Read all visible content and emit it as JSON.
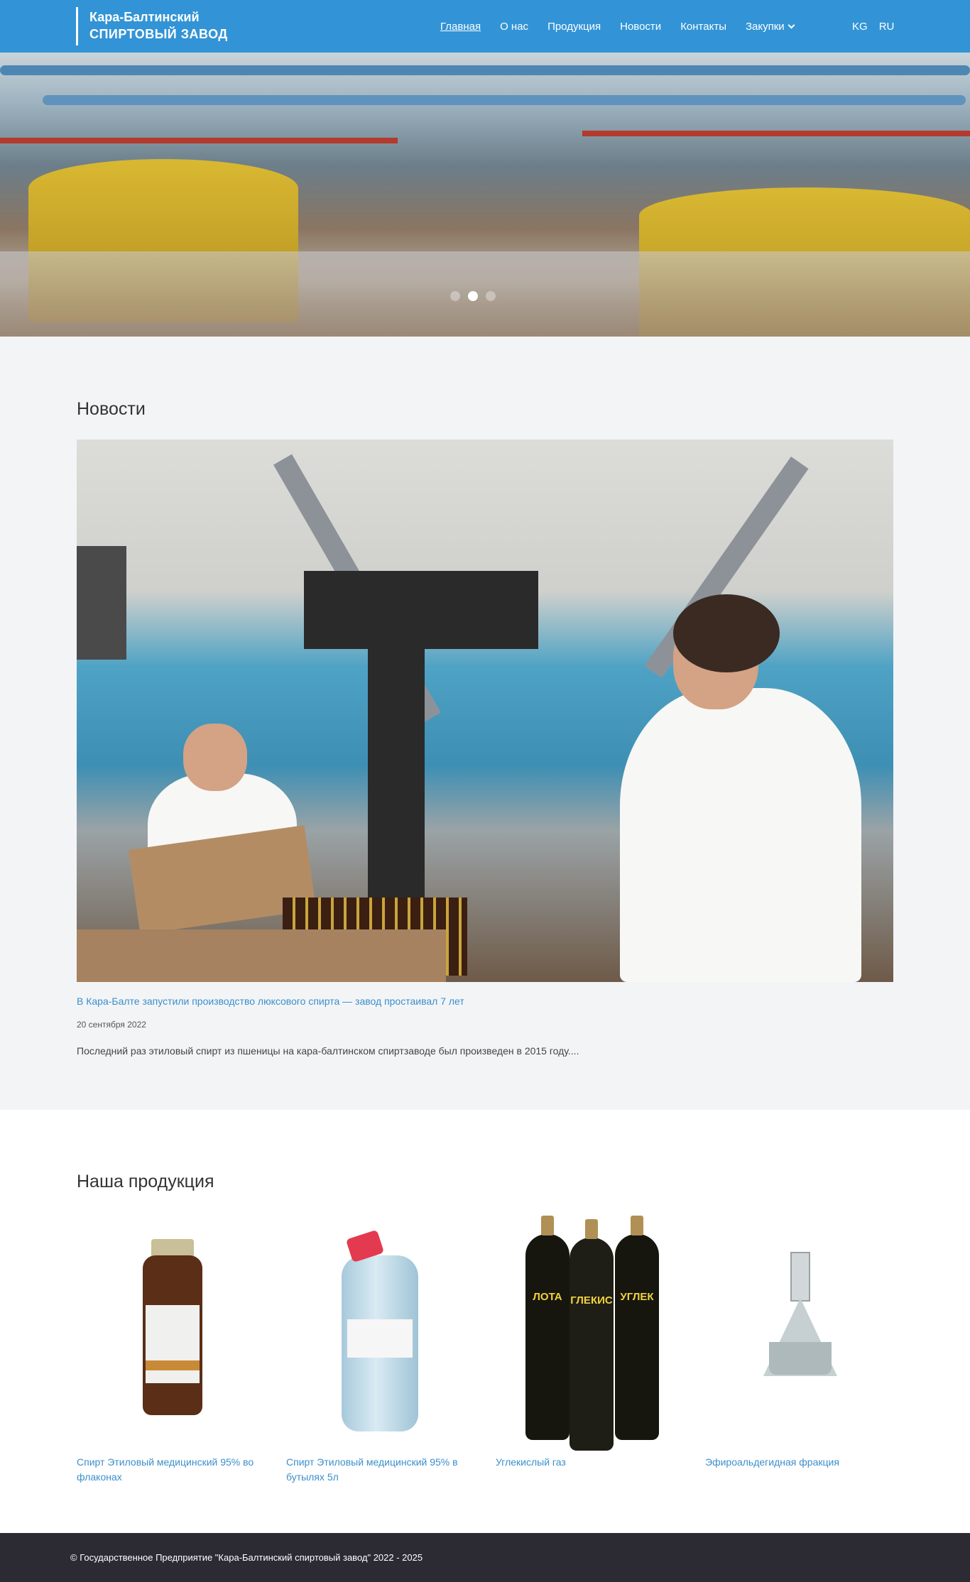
{
  "header": {
    "logo_line1": "Кара-Балтинский",
    "logo_line2": "СПИРТОВЫЙ ЗАВОД",
    "nav": [
      {
        "label": "Главная",
        "active": true
      },
      {
        "label": "О нас"
      },
      {
        "label": "Продукция"
      },
      {
        "label": "Новости"
      },
      {
        "label": "Контакты"
      },
      {
        "label": "Закупки",
        "has_dropdown": true
      }
    ],
    "languages": [
      "KG",
      "RU"
    ],
    "background_color": "#3294d6"
  },
  "hero": {
    "slides": 3,
    "active_slide": 2
  },
  "news": {
    "title": "Новости",
    "items": [
      {
        "headline": "В Кара-Балте запустили производство люксового спирта — завод простаивал 7 лет",
        "date": "20 сентября 2022",
        "excerpt": "Последний раз этиловый спирт из пшеницы на кара-балтинском спиртзаводе был произведен в 2015 году...."
      }
    ]
  },
  "products": {
    "title": "Наша продукция",
    "items": [
      {
        "name": "Спирт Этиловый медицинский 95% во флаконах"
      },
      {
        "name": "Спирт Этиловый медицинский 95% в бутылях 5л"
      },
      {
        "name": "Углекислый газ",
        "cylinder_labels": [
          "ЛОТА",
          "ГЛЕКИС",
          "УГЛЕК"
        ]
      },
      {
        "name": "Эфироальдегидная фракция"
      }
    ]
  },
  "footer": {
    "copyright": "© Государственное Предприятие \"Кара-Балтинский спиртовый завод\" 2022 - 2025"
  },
  "colors": {
    "accent": "#3294d6",
    "link": "#3b8fcb",
    "footer_bg": "#2c2b34"
  }
}
